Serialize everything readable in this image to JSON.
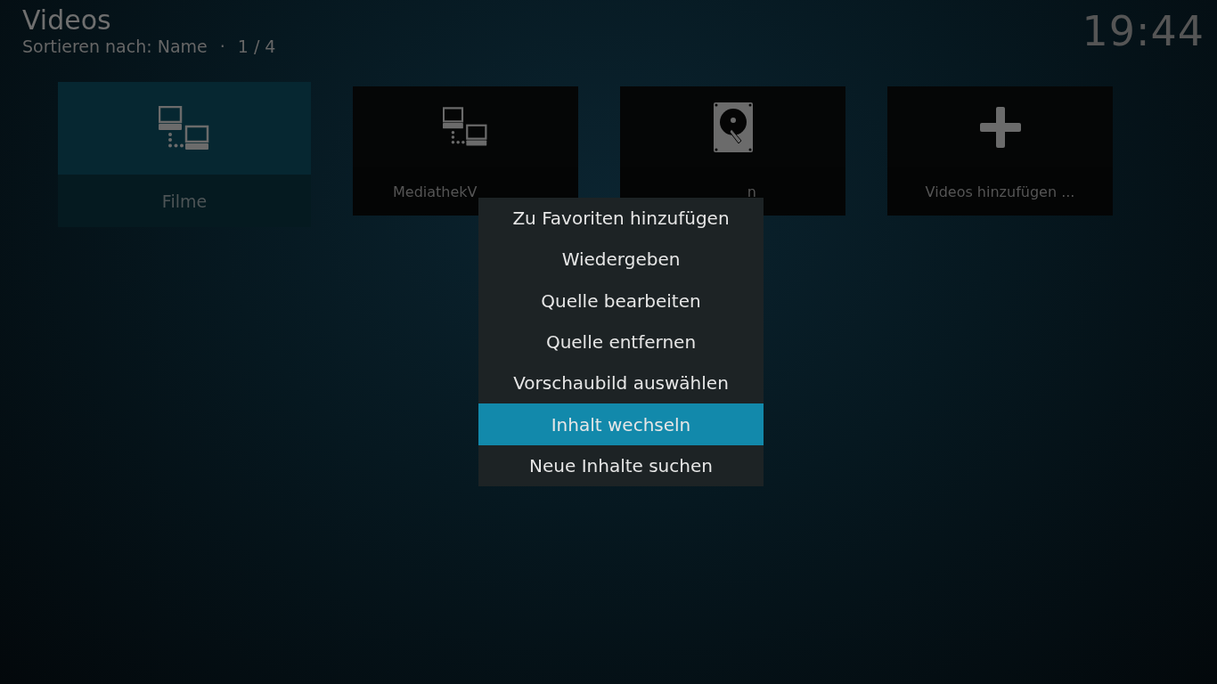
{
  "header": {
    "title": "Videos",
    "sort_label": "Sortieren nach: Name",
    "separator": "·",
    "page": "1 / 4"
  },
  "clock": "19:44",
  "tiles": [
    {
      "kind": "network",
      "label": "Filme",
      "selected": true
    },
    {
      "kind": "network",
      "label": "MediathekV",
      "selected": false
    },
    {
      "kind": "harddisk",
      "label": "n",
      "selected": false
    },
    {
      "kind": "add",
      "label": "Videos hinzufügen ...",
      "selected": false
    }
  ],
  "context_menu": {
    "items": [
      {
        "label": "Zu Favoriten hinzufügen",
        "selected": false
      },
      {
        "label": "Wiedergeben",
        "selected": false
      },
      {
        "label": "Quelle bearbeiten",
        "selected": false
      },
      {
        "label": "Quelle entfernen",
        "selected": false
      },
      {
        "label": "Vorschaubild auswählen",
        "selected": false
      },
      {
        "label": "Inhalt wechseln",
        "selected": true
      },
      {
        "label": "Neue Inhalte suchen",
        "selected": false
      }
    ]
  }
}
